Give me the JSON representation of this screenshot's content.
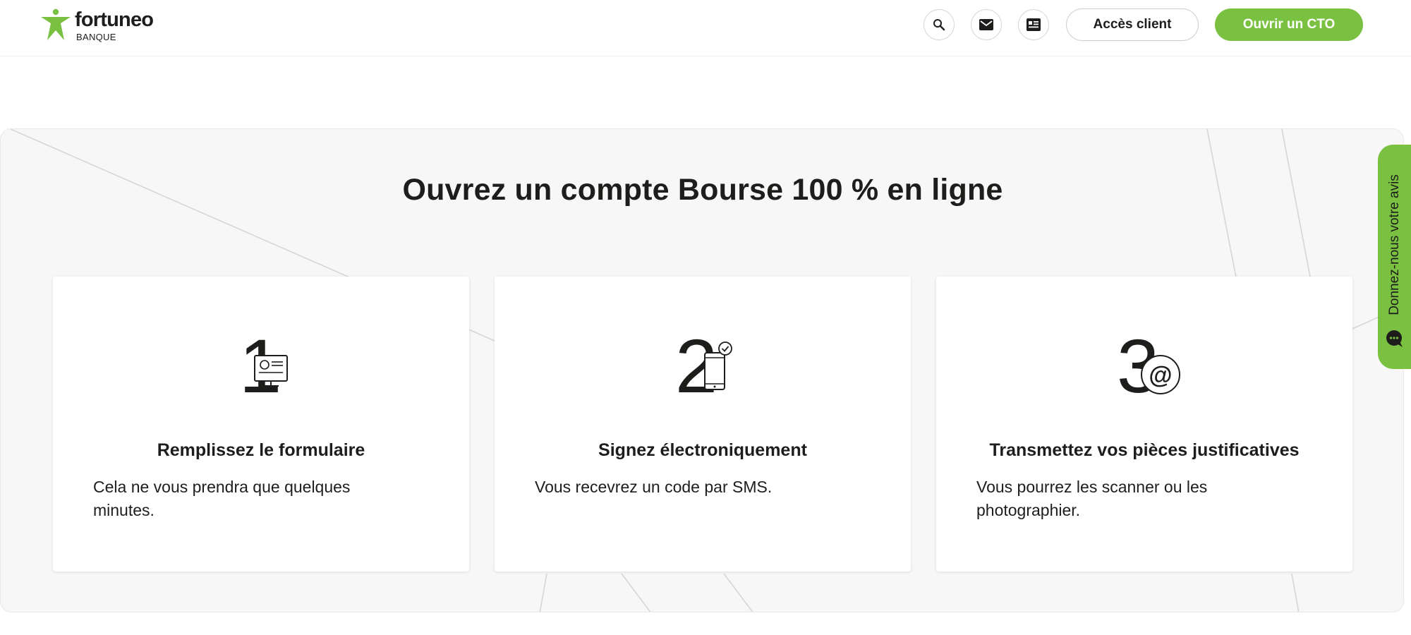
{
  "brand": {
    "name": "fortuneo",
    "subtitle": "BANQUE",
    "accent_color": "#7ac142"
  },
  "header": {
    "search_icon": "search-icon",
    "mail_icon": "mail-icon",
    "news_icon": "newspaper-icon",
    "client_label": "Accès client",
    "cta_label": "Ouvrir un CTO"
  },
  "section": {
    "title": "Ouvrez un compte Bourse 100 % en ligne",
    "steps": [
      {
        "number": "1",
        "icon": "computer-form-icon",
        "title": "Remplissez le formulaire",
        "text": "Cela ne vous prendra que quelques minutes."
      },
      {
        "number": "2",
        "icon": "smartphone-check-icon",
        "title": "Signez électroniquement",
        "text": "Vous recevrez un code par SMS."
      },
      {
        "number": "3",
        "icon": "at-sign-icon",
        "title": "Transmettez vos pièces justificatives",
        "text": "Vous pourrez les scanner ou les photographier."
      }
    ]
  },
  "feedback": {
    "label": "Donnez-nous votre avis",
    "icon": "chat-bubble-icon"
  }
}
